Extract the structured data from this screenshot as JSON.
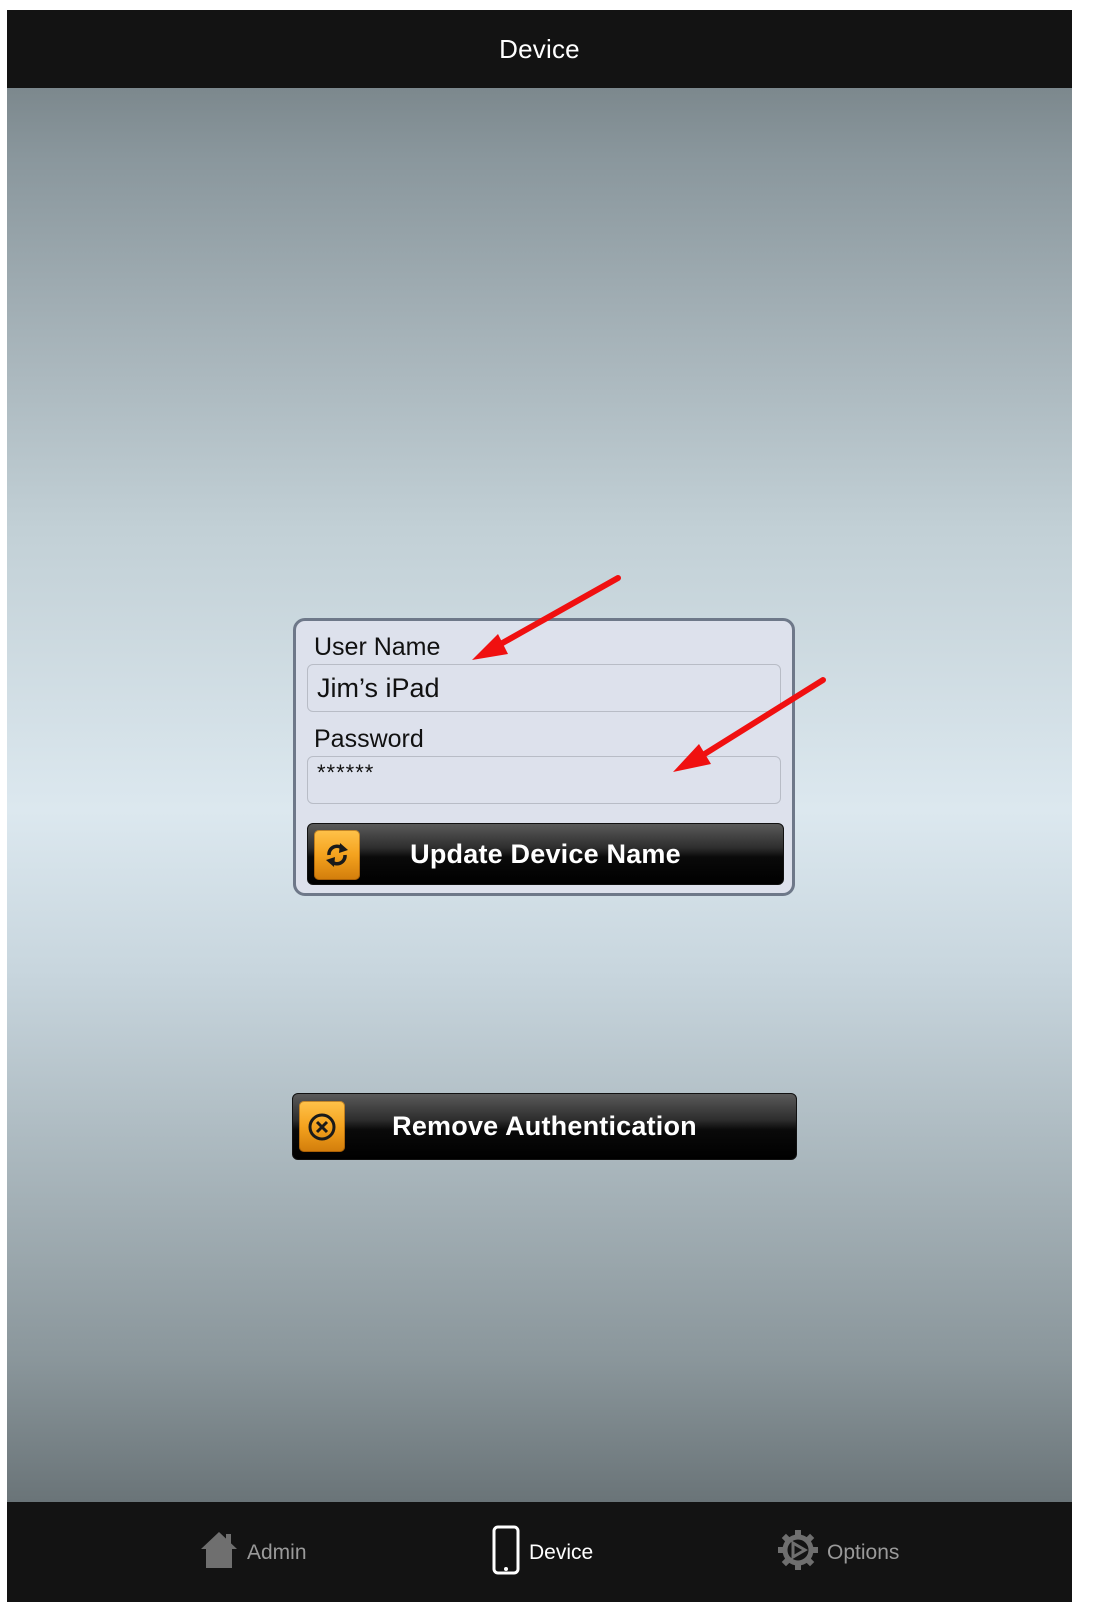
{
  "nav_bar": {
    "title": "Device"
  },
  "login_form": {
    "username_label": "User Name",
    "username_value": "Jim’s iPad",
    "password_label": "Password",
    "password_value": "******",
    "update_button_label": "Update Device Name",
    "update_button_icon": "refresh-icon"
  },
  "remove_auth": {
    "label": "Remove Authentication",
    "icon": "cancel-circle-icon"
  },
  "annotations": {
    "arrow_color": "#f01010"
  },
  "tab_bar": {
    "tabs": [
      {
        "label": "Admin",
        "icon": "home-icon",
        "selected": false
      },
      {
        "label": "Device",
        "icon": "device-icon",
        "selected": true
      },
      {
        "label": "Options",
        "icon": "gear-icon",
        "selected": false
      }
    ]
  },
  "colors": {
    "accent_orange": "#f4a21e",
    "bar_background": "#131313"
  }
}
